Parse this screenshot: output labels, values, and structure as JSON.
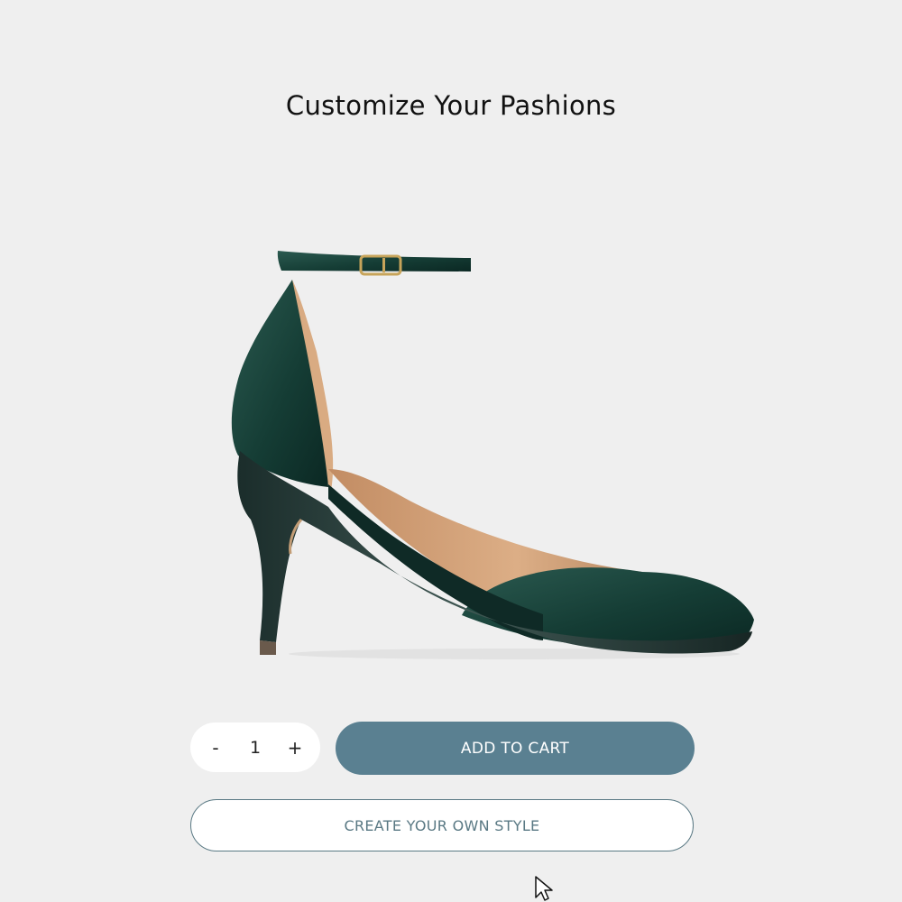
{
  "page": {
    "title": "Customize Your Pashions"
  },
  "product": {
    "image_icon": "green-velvet-heel-image",
    "colors": {
      "velvet": "#163a34",
      "lining": "#d8a77e",
      "heel": "#243532",
      "buckle": "#c7a45a"
    }
  },
  "quantity": {
    "decrement_label": "-",
    "value": "1",
    "increment_label": "+"
  },
  "actions": {
    "add_to_cart_label": "ADD TO CART",
    "create_style_label": "CREATE YOUR OWN STYLE"
  },
  "colors": {
    "background": "#efefef",
    "primary_button": "#5a8091",
    "outline": "#5a7984"
  },
  "cursor_icon": "pointer-cursor-icon"
}
